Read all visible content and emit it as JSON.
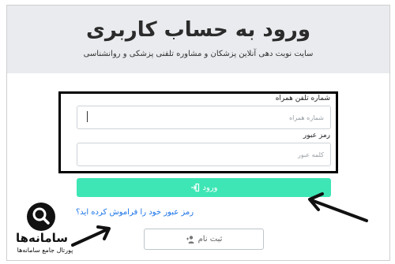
{
  "header": {
    "title": "ورود به حساب کاربری",
    "subtitle": "سایت نوبت دهی آنلاین پزشکان و مشاوره تلفنی پزشکی و روانشناسی"
  },
  "form": {
    "phone_label": "شماره تلفن همراه",
    "phone_placeholder": "شماره همراه",
    "password_label": "رمز عبور",
    "password_placeholder": "کلمه عبور",
    "login_label": "ورود",
    "forgot_link": "رمز عبور خود را فراموش کرده اید؟",
    "register_label": "ثبت نام"
  },
  "logo": {
    "name": "سامانه‌ها",
    "tagline": "پورتال جامع سامانه‌ها"
  },
  "colors": {
    "accent": "#3ee6b5",
    "link": "#1a73e8",
    "header_bg": "#e9ebee"
  }
}
